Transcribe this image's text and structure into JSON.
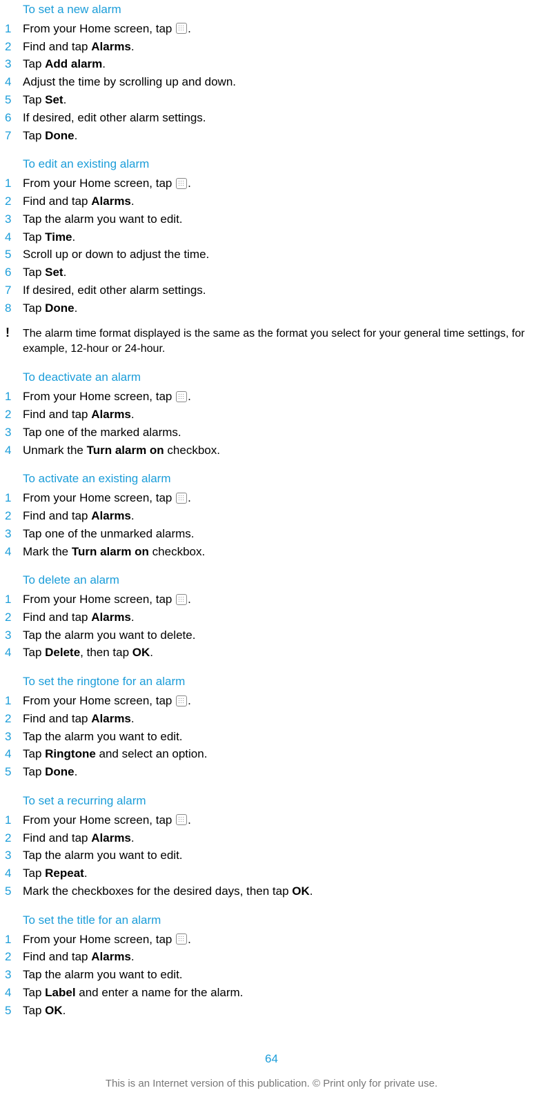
{
  "sections": [
    {
      "heading": "To set a new alarm",
      "steps": [
        [
          [
            "From your Home screen, tap "
          ],
          [
            "__ICON__"
          ],
          [
            "."
          ]
        ],
        [
          [
            "Find and tap "
          ],
          [
            "b",
            "Alarms"
          ],
          [
            "."
          ]
        ],
        [
          [
            "Tap "
          ],
          [
            "b",
            "Add alarm"
          ],
          [
            "."
          ]
        ],
        [
          [
            "Adjust the time by scrolling up and down."
          ]
        ],
        [
          [
            "Tap "
          ],
          [
            "b",
            "Set"
          ],
          [
            "."
          ]
        ],
        [
          [
            "If desired, edit other alarm settings."
          ]
        ],
        [
          [
            "Tap "
          ],
          [
            "b",
            "Done"
          ],
          [
            "."
          ]
        ]
      ]
    },
    {
      "heading": "To edit an existing alarm",
      "steps": [
        [
          [
            "From your Home screen, tap "
          ],
          [
            "__ICON__"
          ],
          [
            "."
          ]
        ],
        [
          [
            "Find and tap "
          ],
          [
            "b",
            "Alarms"
          ],
          [
            "."
          ]
        ],
        [
          [
            "Tap the alarm you want to edit."
          ]
        ],
        [
          [
            "Tap "
          ],
          [
            "b",
            "Time"
          ],
          [
            "."
          ]
        ],
        [
          [
            "Scroll up or down to adjust the time."
          ]
        ],
        [
          [
            "Tap "
          ],
          [
            "b",
            "Set"
          ],
          [
            "."
          ]
        ],
        [
          [
            "If desired, edit other alarm settings."
          ]
        ],
        [
          [
            "Tap "
          ],
          [
            "b",
            "Done"
          ],
          [
            "."
          ]
        ]
      ]
    }
  ],
  "note": "The alarm time format displayed is the same as the format you select for your general time settings, for example, 12-hour or 24-hour.",
  "sections2": [
    {
      "heading": "To deactivate an alarm",
      "steps": [
        [
          [
            "From your Home screen, tap "
          ],
          [
            "__ICON__"
          ],
          [
            "."
          ]
        ],
        [
          [
            "Find and tap "
          ],
          [
            "b",
            "Alarms"
          ],
          [
            "."
          ]
        ],
        [
          [
            "Tap one of the marked alarms."
          ]
        ],
        [
          [
            "Unmark the "
          ],
          [
            "b",
            "Turn alarm on"
          ],
          [
            " checkbox."
          ]
        ]
      ]
    },
    {
      "heading": "To activate an existing alarm",
      "steps": [
        [
          [
            "From your Home screen, tap "
          ],
          [
            "__ICON__"
          ],
          [
            "."
          ]
        ],
        [
          [
            "Find and tap "
          ],
          [
            "b",
            "Alarms"
          ],
          [
            "."
          ]
        ],
        [
          [
            "Tap one of the unmarked alarms."
          ]
        ],
        [
          [
            "Mark the "
          ],
          [
            "b",
            "Turn alarm on"
          ],
          [
            " checkbox."
          ]
        ]
      ]
    },
    {
      "heading": "To delete an alarm",
      "steps": [
        [
          [
            "From your Home screen, tap "
          ],
          [
            "__ICON__"
          ],
          [
            "."
          ]
        ],
        [
          [
            "Find and tap "
          ],
          [
            "b",
            "Alarms"
          ],
          [
            "."
          ]
        ],
        [
          [
            "Tap the alarm you want to delete."
          ]
        ],
        [
          [
            "Tap "
          ],
          [
            "b",
            "Delete"
          ],
          [
            ", then tap "
          ],
          [
            "b",
            "OK"
          ],
          [
            "."
          ]
        ]
      ]
    },
    {
      "heading": "To set the ringtone for an alarm",
      "steps": [
        [
          [
            "From your Home screen, tap "
          ],
          [
            "__ICON__"
          ],
          [
            "."
          ]
        ],
        [
          [
            "Find and tap "
          ],
          [
            "b",
            "Alarms"
          ],
          [
            "."
          ]
        ],
        [
          [
            "Tap the alarm you want to edit."
          ]
        ],
        [
          [
            "Tap "
          ],
          [
            "b",
            "Ringtone"
          ],
          [
            " and select an option."
          ]
        ],
        [
          [
            "Tap "
          ],
          [
            "b",
            "Done"
          ],
          [
            "."
          ]
        ]
      ]
    },
    {
      "heading": "To set a recurring alarm",
      "steps": [
        [
          [
            "From your Home screen, tap "
          ],
          [
            "__ICON__"
          ],
          [
            "."
          ]
        ],
        [
          [
            "Find and tap "
          ],
          [
            "b",
            "Alarms"
          ],
          [
            "."
          ]
        ],
        [
          [
            "Tap the alarm you want to edit."
          ]
        ],
        [
          [
            "Tap "
          ],
          [
            "b",
            "Repeat"
          ],
          [
            "."
          ]
        ],
        [
          [
            "Mark the checkboxes for the desired days, then tap "
          ],
          [
            "b",
            "OK"
          ],
          [
            "."
          ]
        ]
      ]
    },
    {
      "heading": "To set the title for an alarm",
      "steps": [
        [
          [
            "From your Home screen, tap "
          ],
          [
            "__ICON__"
          ],
          [
            "."
          ]
        ],
        [
          [
            "Find and tap "
          ],
          [
            "b",
            "Alarms"
          ],
          [
            "."
          ]
        ],
        [
          [
            "Tap the alarm you want to edit."
          ]
        ],
        [
          [
            "Tap "
          ],
          [
            "b",
            "Label"
          ],
          [
            " and enter a name for the alarm."
          ]
        ],
        [
          [
            "Tap "
          ],
          [
            "b",
            "OK"
          ],
          [
            "."
          ]
        ]
      ]
    }
  ],
  "page_number": "64",
  "footer": "This is an Internet version of this publication. © Print only for private use."
}
